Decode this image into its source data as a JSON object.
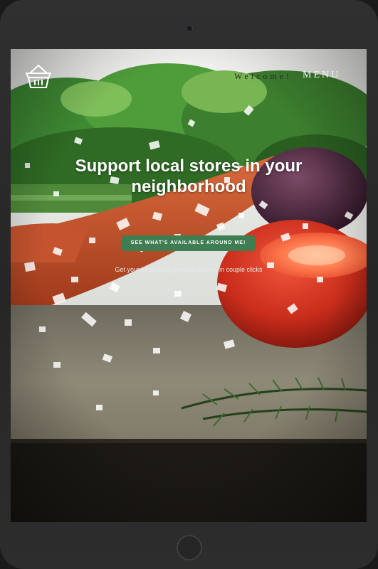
{
  "header": {
    "logo_icon": "basket-icon",
    "welcome_text": "Welcome!",
    "menu_label": "MENU"
  },
  "hero": {
    "headline": "Support local stores in your neighborhood",
    "cta_label": "SEE WHAT'S AVAILABLE AROUND ME!",
    "subtext": "Get your fresh local products basket in couple clicks",
    "background": "vegetables-with-salt-photo"
  },
  "colors": {
    "accent": "#3f7d52",
    "device_frame": "#2b2b2b",
    "headline": "#ffffff"
  }
}
